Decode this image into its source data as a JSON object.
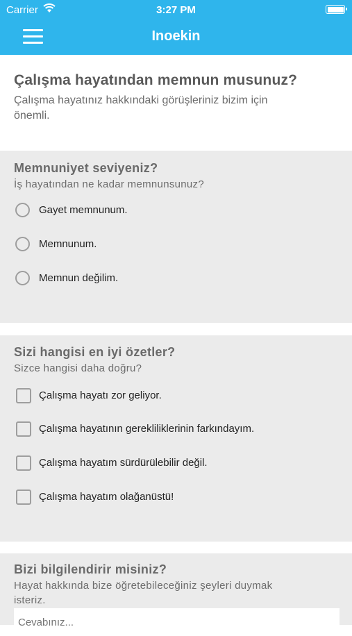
{
  "status": {
    "carrier": "Carrier",
    "time": "3:27 PM"
  },
  "nav": {
    "title": "Inoekin"
  },
  "intro": {
    "title": "Çalışma hayatından memnun musunuz?",
    "subtitle": "Çalışma hayatınız hakkındaki görüşleriniz bizim için önemli."
  },
  "q1": {
    "title": "Memnuniyet seviyeniz?",
    "subtitle": "İş hayatından ne kadar memnunsunuz?",
    "options": [
      "Gayet memnunum.",
      "Memnunum.",
      "Memnun değilim."
    ]
  },
  "q2": {
    "title": "Sizi hangisi en iyi özetler?",
    "subtitle": "Sizce hangisi daha doğru?",
    "options": [
      "Çalışma hayatı zor geliyor.",
      "Çalışma hayatının gerekliliklerinin farkındayım.",
      "Çalışma hayatım sürdürülebilir değil.",
      "Çalışma hayatım olağanüstü!"
    ]
  },
  "q3": {
    "title": "Bizi bilgilendirir misiniz?",
    "subtitle": "Hayat hakkında bize öğretebileceğiniz şeyleri duymak isteriz.",
    "placeholder": "Cevabınız..."
  }
}
